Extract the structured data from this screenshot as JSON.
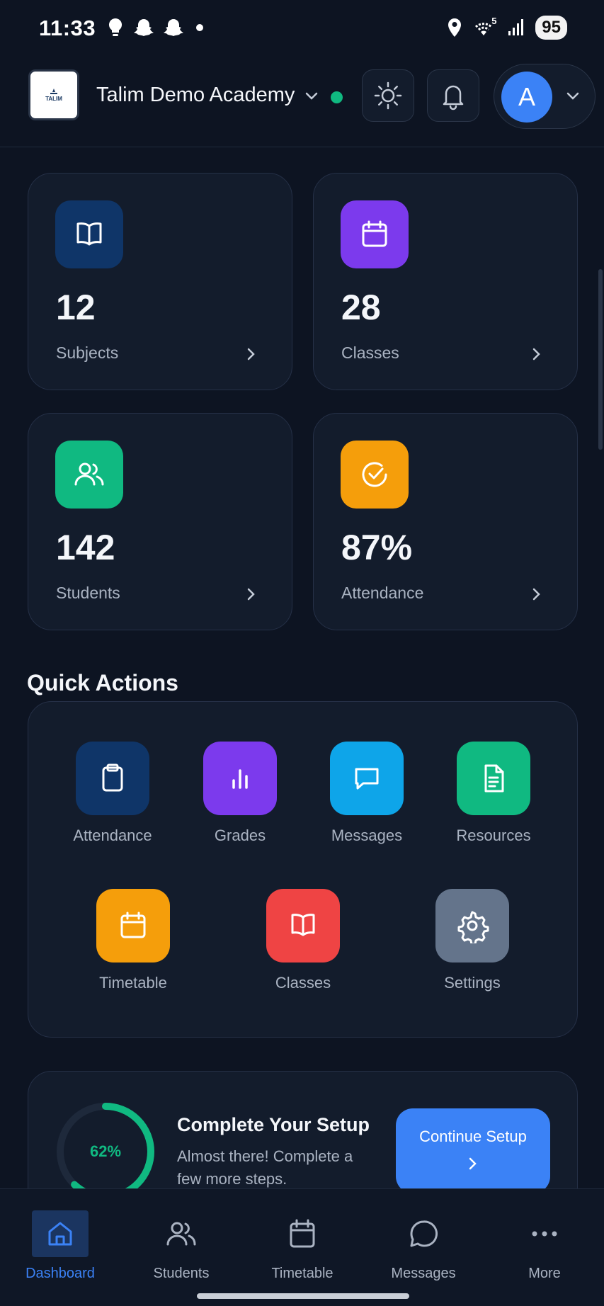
{
  "status_bar": {
    "time": "11:33",
    "icons_left": [
      "bulb-icon",
      "snapchat-icon",
      "snapchat-icon",
      "dot-icon"
    ],
    "icons_right": [
      "location-icon",
      "wifi-icon",
      "signal-icon"
    ],
    "wifi_label": "5",
    "battery": "95"
  },
  "header": {
    "logo_text": "TALIM",
    "school_name": "Talim Demo Academy",
    "online_status_color": "#10b981",
    "avatar_letter": "A"
  },
  "stats": [
    {
      "value": "12",
      "label": "Subjects",
      "icon": "book-icon",
      "color": "#0f3568"
    },
    {
      "value": "28",
      "label": "Classes",
      "icon": "calendar-icon",
      "color": "#7c3aed"
    },
    {
      "value": "142",
      "label": "Students",
      "icon": "users-icon",
      "color": "#10b981"
    },
    {
      "value": "87%",
      "label": "Attendance",
      "icon": "check-circle-icon",
      "color": "#f59e0b"
    }
  ],
  "quick_actions": {
    "title": "Quick Actions",
    "items": [
      {
        "label": "Attendance",
        "icon": "clipboard-icon",
        "color": "#0f3568"
      },
      {
        "label": "Grades",
        "icon": "bar-chart-icon",
        "color": "#7c3aed"
      },
      {
        "label": "Messages",
        "icon": "message-icon",
        "color": "#0ea5e9"
      },
      {
        "label": "Resources",
        "icon": "document-icon",
        "color": "#10b981"
      },
      {
        "label": "Timetable",
        "icon": "calendar-icon",
        "color": "#f59e0b"
      },
      {
        "label": "Classes",
        "icon": "book-icon",
        "color": "#ef4444"
      },
      {
        "label": "Settings",
        "icon": "gear-icon",
        "color": "#64748b"
      }
    ]
  },
  "setup": {
    "progress_label": "62%",
    "progress": 0.62,
    "title": "Complete Your Setup",
    "subtitle": "Almost there! Complete a few more steps.",
    "button_label": "Continue Setup"
  },
  "bottom_nav": {
    "items": [
      {
        "label": "Dashboard",
        "icon": "home-icon",
        "active": true
      },
      {
        "label": "Students",
        "icon": "users-icon",
        "active": false
      },
      {
        "label": "Timetable",
        "icon": "calendar-icon",
        "active": false
      },
      {
        "label": "Messages",
        "icon": "message-icon",
        "active": false
      },
      {
        "label": "More",
        "icon": "more-dots-icon",
        "active": false
      }
    ]
  }
}
